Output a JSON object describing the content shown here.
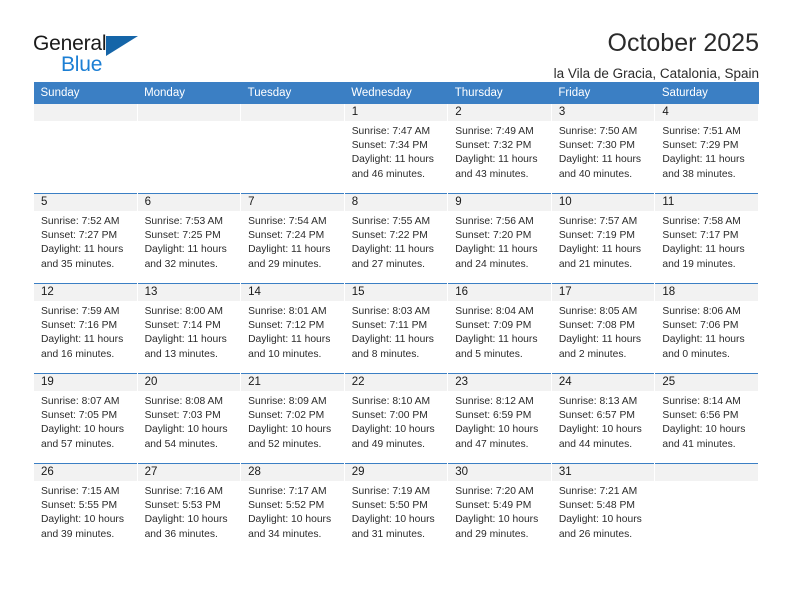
{
  "brand": {
    "name_top": "General",
    "name_bottom": "Blue",
    "accent_color": "#1c7fd4",
    "triangle_color": "#1565a8"
  },
  "header": {
    "title": "October 2025",
    "subtitle": "la Vila de Gracia, Catalonia, Spain"
  },
  "theme": {
    "header_bg": "#3b7fc4",
    "daynum_bg": "#f2f2f2",
    "text": "#2b2b2b"
  },
  "weekdays": [
    "Sunday",
    "Monday",
    "Tuesday",
    "Wednesday",
    "Thursday",
    "Friday",
    "Saturday"
  ],
  "labels": {
    "sunrise_prefix": "Sunrise:",
    "sunset_prefix": "Sunset:",
    "daylight_prefix": "Daylight:"
  },
  "weeks": [
    [
      {
        "day": "",
        "empty": true
      },
      {
        "day": "",
        "empty": true
      },
      {
        "day": "",
        "empty": true
      },
      {
        "day": "1",
        "sunrise": "Sunrise: 7:47 AM",
        "sunset": "Sunset: 7:34 PM",
        "daylight": "Daylight: 11 hours and 46 minutes."
      },
      {
        "day": "2",
        "sunrise": "Sunrise: 7:49 AM",
        "sunset": "Sunset: 7:32 PM",
        "daylight": "Daylight: 11 hours and 43 minutes."
      },
      {
        "day": "3",
        "sunrise": "Sunrise: 7:50 AM",
        "sunset": "Sunset: 7:30 PM",
        "daylight": "Daylight: 11 hours and 40 minutes."
      },
      {
        "day": "4",
        "sunrise": "Sunrise: 7:51 AM",
        "sunset": "Sunset: 7:29 PM",
        "daylight": "Daylight: 11 hours and 38 minutes."
      }
    ],
    [
      {
        "day": "5",
        "sunrise": "Sunrise: 7:52 AM",
        "sunset": "Sunset: 7:27 PM",
        "daylight": "Daylight: 11 hours and 35 minutes."
      },
      {
        "day": "6",
        "sunrise": "Sunrise: 7:53 AM",
        "sunset": "Sunset: 7:25 PM",
        "daylight": "Daylight: 11 hours and 32 minutes."
      },
      {
        "day": "7",
        "sunrise": "Sunrise: 7:54 AM",
        "sunset": "Sunset: 7:24 PM",
        "daylight": "Daylight: 11 hours and 29 minutes."
      },
      {
        "day": "8",
        "sunrise": "Sunrise: 7:55 AM",
        "sunset": "Sunset: 7:22 PM",
        "daylight": "Daylight: 11 hours and 27 minutes."
      },
      {
        "day": "9",
        "sunrise": "Sunrise: 7:56 AM",
        "sunset": "Sunset: 7:20 PM",
        "daylight": "Daylight: 11 hours and 24 minutes."
      },
      {
        "day": "10",
        "sunrise": "Sunrise: 7:57 AM",
        "sunset": "Sunset: 7:19 PM",
        "daylight": "Daylight: 11 hours and 21 minutes."
      },
      {
        "day": "11",
        "sunrise": "Sunrise: 7:58 AM",
        "sunset": "Sunset: 7:17 PM",
        "daylight": "Daylight: 11 hours and 19 minutes."
      }
    ],
    [
      {
        "day": "12",
        "sunrise": "Sunrise: 7:59 AM",
        "sunset": "Sunset: 7:16 PM",
        "daylight": "Daylight: 11 hours and 16 minutes."
      },
      {
        "day": "13",
        "sunrise": "Sunrise: 8:00 AM",
        "sunset": "Sunset: 7:14 PM",
        "daylight": "Daylight: 11 hours and 13 minutes."
      },
      {
        "day": "14",
        "sunrise": "Sunrise: 8:01 AM",
        "sunset": "Sunset: 7:12 PM",
        "daylight": "Daylight: 11 hours and 10 minutes."
      },
      {
        "day": "15",
        "sunrise": "Sunrise: 8:03 AM",
        "sunset": "Sunset: 7:11 PM",
        "daylight": "Daylight: 11 hours and 8 minutes."
      },
      {
        "day": "16",
        "sunrise": "Sunrise: 8:04 AM",
        "sunset": "Sunset: 7:09 PM",
        "daylight": "Daylight: 11 hours and 5 minutes."
      },
      {
        "day": "17",
        "sunrise": "Sunrise: 8:05 AM",
        "sunset": "Sunset: 7:08 PM",
        "daylight": "Daylight: 11 hours and 2 minutes."
      },
      {
        "day": "18",
        "sunrise": "Sunrise: 8:06 AM",
        "sunset": "Sunset: 7:06 PM",
        "daylight": "Daylight: 11 hours and 0 minutes."
      }
    ],
    [
      {
        "day": "19",
        "sunrise": "Sunrise: 8:07 AM",
        "sunset": "Sunset: 7:05 PM",
        "daylight": "Daylight: 10 hours and 57 minutes."
      },
      {
        "day": "20",
        "sunrise": "Sunrise: 8:08 AM",
        "sunset": "Sunset: 7:03 PM",
        "daylight": "Daylight: 10 hours and 54 minutes."
      },
      {
        "day": "21",
        "sunrise": "Sunrise: 8:09 AM",
        "sunset": "Sunset: 7:02 PM",
        "daylight": "Daylight: 10 hours and 52 minutes."
      },
      {
        "day": "22",
        "sunrise": "Sunrise: 8:10 AM",
        "sunset": "Sunset: 7:00 PM",
        "daylight": "Daylight: 10 hours and 49 minutes."
      },
      {
        "day": "23",
        "sunrise": "Sunrise: 8:12 AM",
        "sunset": "Sunset: 6:59 PM",
        "daylight": "Daylight: 10 hours and 47 minutes."
      },
      {
        "day": "24",
        "sunrise": "Sunrise: 8:13 AM",
        "sunset": "Sunset: 6:57 PM",
        "daylight": "Daylight: 10 hours and 44 minutes."
      },
      {
        "day": "25",
        "sunrise": "Sunrise: 8:14 AM",
        "sunset": "Sunset: 6:56 PM",
        "daylight": "Daylight: 10 hours and 41 minutes."
      }
    ],
    [
      {
        "day": "26",
        "sunrise": "Sunrise: 7:15 AM",
        "sunset": "Sunset: 5:55 PM",
        "daylight": "Daylight: 10 hours and 39 minutes."
      },
      {
        "day": "27",
        "sunrise": "Sunrise: 7:16 AM",
        "sunset": "Sunset: 5:53 PM",
        "daylight": "Daylight: 10 hours and 36 minutes."
      },
      {
        "day": "28",
        "sunrise": "Sunrise: 7:17 AM",
        "sunset": "Sunset: 5:52 PM",
        "daylight": "Daylight: 10 hours and 34 minutes."
      },
      {
        "day": "29",
        "sunrise": "Sunrise: 7:19 AM",
        "sunset": "Sunset: 5:50 PM",
        "daylight": "Daylight: 10 hours and 31 minutes."
      },
      {
        "day": "30",
        "sunrise": "Sunrise: 7:20 AM",
        "sunset": "Sunset: 5:49 PM",
        "daylight": "Daylight: 10 hours and 29 minutes."
      },
      {
        "day": "31",
        "sunrise": "Sunrise: 7:21 AM",
        "sunset": "Sunset: 5:48 PM",
        "daylight": "Daylight: 10 hours and 26 minutes."
      },
      {
        "day": "",
        "empty": true
      }
    ]
  ]
}
